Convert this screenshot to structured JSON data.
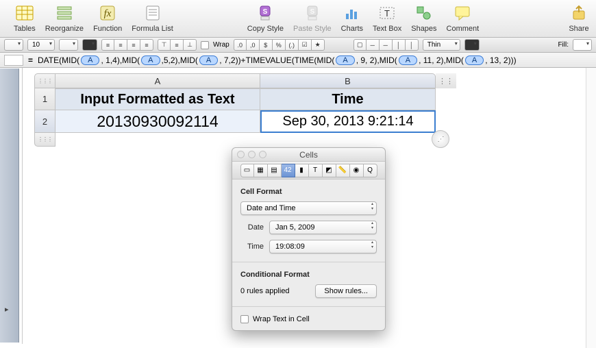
{
  "toolbar": {
    "tables": "Tables",
    "reorganize": "Reorganize",
    "function": "Function",
    "formula_list": "Formula List",
    "copy_style": "Copy Style",
    "paste_style": "Paste Style",
    "charts": "Charts",
    "text_box": "Text Box",
    "shapes": "Shapes",
    "comment": "Comment",
    "share": "Share"
  },
  "fmt": {
    "size": "10",
    "wrap": "Wrap",
    "num_dec": ".0",
    "num_sep": ",0",
    "cur": "$",
    "pct": "%",
    "paren": "(.)",
    "chk": "☑",
    "star": "★",
    "border_style": "Thin",
    "fill": "Fill:"
  },
  "formula": {
    "fn": "DATE",
    "mid": "MID",
    "tv": "TIMEVALUE",
    "tm": "TIME",
    "ref": "A",
    "p1": ", 1,4),",
    "p2": ",5,2),",
    "p3": ", 7,2))+",
    "p4": ", 9, 2), ",
    "p5": ", 11, 2), ",
    "p6": ", 13, 2)))"
  },
  "table": {
    "colA": "A",
    "colB": "B",
    "row1": "1",
    "row2": "2",
    "A1": "Input Formatted as Text",
    "B1": "Time",
    "A2": "20130930092114",
    "B2": "Sep 30, 2013 9:21:14"
  },
  "inspector": {
    "title": "Cells",
    "format_h": "Cell Format",
    "type": "Date and Time",
    "date_l": "Date",
    "date_v": "Jan 5, 2009",
    "time_l": "Time",
    "time_v": "19:08:09",
    "cond_h": "Conditional Format",
    "rules_applied": "0 rules applied",
    "show_rules": "Show rules...",
    "wrap": "Wrap Text in Cell"
  }
}
